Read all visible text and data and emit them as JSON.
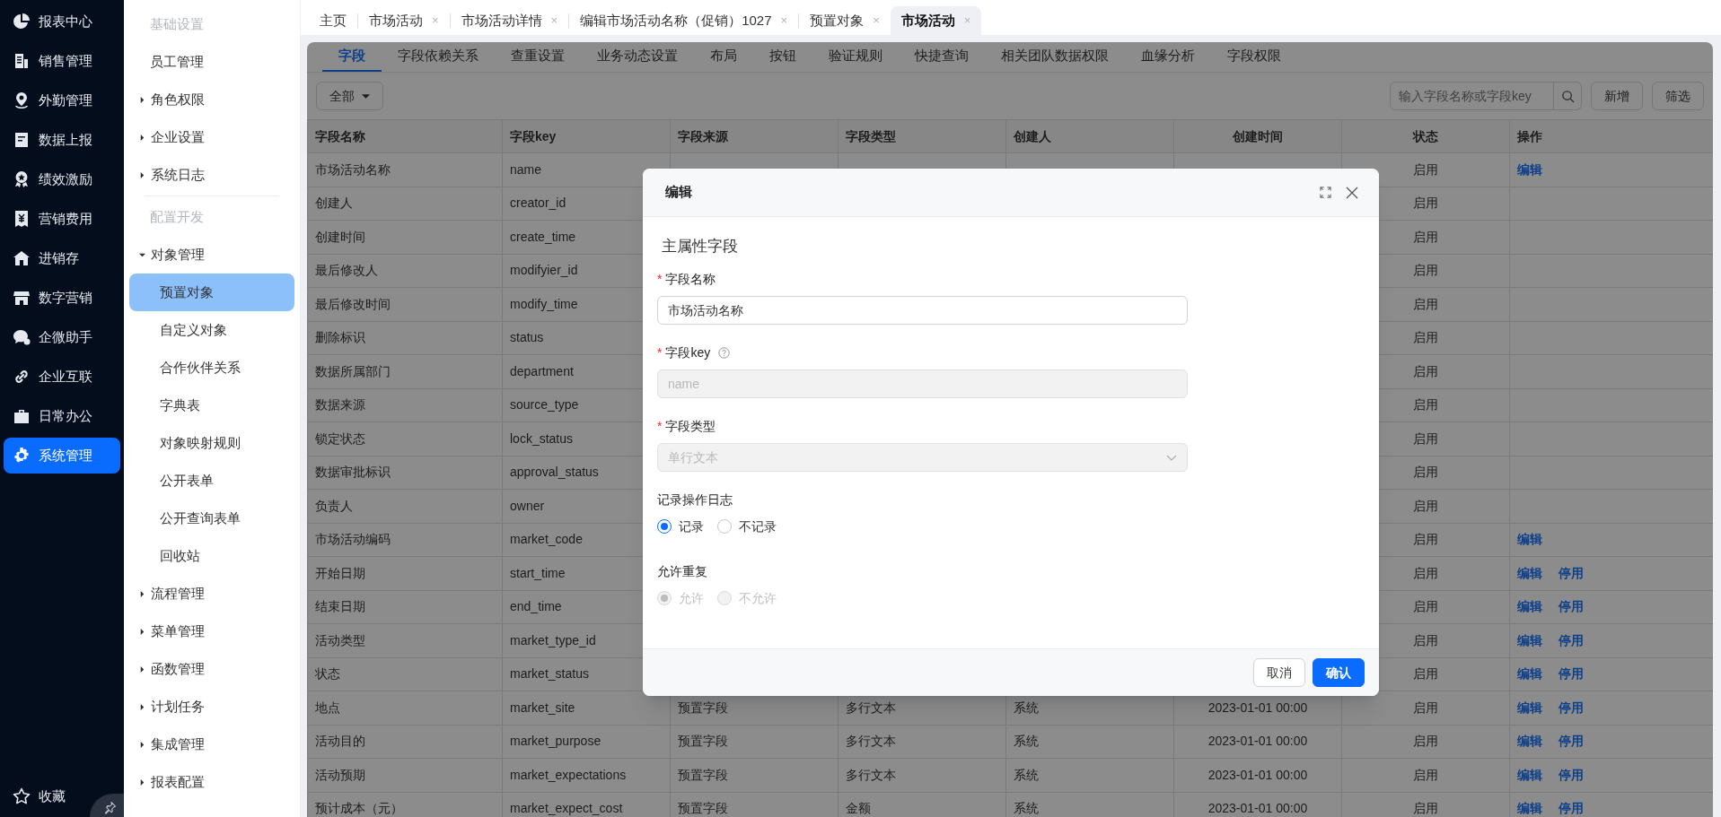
{
  "nav": {
    "items": [
      {
        "label": "报表中心",
        "selected": false
      },
      {
        "label": "销售管理",
        "selected": false
      },
      {
        "label": "外勤管理",
        "selected": false
      },
      {
        "label": "数据上报",
        "selected": false
      },
      {
        "label": "绩效激励",
        "selected": false
      },
      {
        "label": "营销费用",
        "selected": false
      },
      {
        "label": "进销存",
        "selected": false
      },
      {
        "label": "数字营销",
        "selected": false
      },
      {
        "label": "企微助手",
        "selected": false
      },
      {
        "label": "企业互联",
        "selected": false
      },
      {
        "label": "日常办公",
        "selected": false
      },
      {
        "label": "系统管理",
        "selected": true
      }
    ],
    "favorites": "收藏"
  },
  "menu": {
    "sections": [
      {
        "title": "基础设置",
        "items": [
          {
            "label": "员工管理",
            "kind": "link",
            "selected": false
          },
          {
            "label": "角色权限",
            "kind": "folder",
            "expanded": false
          },
          {
            "label": "企业设置",
            "kind": "folder",
            "expanded": false
          },
          {
            "label": "系统日志",
            "kind": "folder",
            "expanded": false
          }
        ]
      },
      {
        "title": "配置开发",
        "items": [
          {
            "label": "对象管理",
            "kind": "folder",
            "expanded": true,
            "children": [
              {
                "label": "预置对象",
                "selected": true
              },
              {
                "label": "自定义对象",
                "selected": false
              },
              {
                "label": "合作伙伴关系",
                "selected": false
              },
              {
                "label": "字典表",
                "selected": false
              },
              {
                "label": "对象映射规则",
                "selected": false
              },
              {
                "label": "公开表单",
                "selected": false
              },
              {
                "label": "公开查询表单",
                "selected": false
              },
              {
                "label": "回收站",
                "selected": false
              }
            ]
          },
          {
            "label": "流程管理",
            "kind": "folder",
            "expanded": false
          },
          {
            "label": "菜单管理",
            "kind": "folder",
            "expanded": false
          },
          {
            "label": "函数管理",
            "kind": "folder",
            "expanded": false
          },
          {
            "label": "计划任务",
            "kind": "folder",
            "expanded": false
          },
          {
            "label": "集成管理",
            "kind": "folder",
            "expanded": false
          },
          {
            "label": "报表配置",
            "kind": "folder",
            "expanded": false
          }
        ]
      }
    ]
  },
  "tabs": [
    {
      "label": "主页",
      "closable": false,
      "selected": false
    },
    {
      "label": "市场活动",
      "closable": true,
      "selected": false
    },
    {
      "label": "市场活动详情",
      "closable": true,
      "selected": false
    },
    {
      "label": "编辑市场活动名称（促销）1027",
      "closable": true,
      "selected": false
    },
    {
      "label": "预置对象",
      "closable": true,
      "selected": false
    },
    {
      "label": "市场活动",
      "closable": true,
      "selected": true
    }
  ],
  "close_mark": "×",
  "subtabs": [
    {
      "label": "字段",
      "selected": true
    },
    {
      "label": "字段依赖关系",
      "selected": false
    },
    {
      "label": "查重设置",
      "selected": false
    },
    {
      "label": "业务动态设置",
      "selected": false
    },
    {
      "label": "布局",
      "selected": false
    },
    {
      "label": "按钮",
      "selected": false
    },
    {
      "label": "验证规则",
      "selected": false
    },
    {
      "label": "快捷查询",
      "selected": false
    },
    {
      "label": "相关团队数据权限",
      "selected": false
    },
    {
      "label": "血缘分析",
      "selected": false
    },
    {
      "label": "字段权限",
      "selected": false
    }
  ],
  "toolbar": {
    "filter": "全部",
    "search": {
      "placeholder": "输入字段名称或字段key"
    },
    "buttons": [
      "新增",
      "筛选"
    ]
  },
  "table": {
    "columns": [
      "字段名称",
      "字段key",
      "字段来源",
      "字段类型",
      "创建人",
      "创建时间",
      "状态",
      "操作"
    ],
    "rows": [
      {
        "name": "市场活动名称",
        "key": "name",
        "status": "启用",
        "actions": [
          "编辑"
        ]
      },
      {
        "name": "创建人",
        "key": "creator_id",
        "status": "启用"
      },
      {
        "name": "创建时间",
        "key": "create_time",
        "status": "启用"
      },
      {
        "name": "最后修改人",
        "key": "modifyier_id",
        "status": "启用"
      },
      {
        "name": "最后修改时间",
        "key": "modify_time",
        "status": "启用"
      },
      {
        "name": "删除标识",
        "key": "status",
        "status": "启用"
      },
      {
        "name": "数据所属部门",
        "key": "department",
        "status": "启用"
      },
      {
        "name": "数据来源",
        "key": "source_type",
        "status": "启用"
      },
      {
        "name": "锁定状态",
        "key": "lock_status",
        "status": "启用"
      },
      {
        "name": "数据审批标识",
        "key": "approval_status",
        "status": "启用"
      },
      {
        "name": "负责人",
        "key": "owner",
        "status": "启用"
      },
      {
        "name": "市场活动编码",
        "key": "market_code",
        "status": "启用",
        "actions": [
          "编辑"
        ]
      },
      {
        "name": "开始日期",
        "key": "start_time",
        "status": "启用",
        "actions": [
          "编辑",
          "停用"
        ]
      },
      {
        "name": "结束日期",
        "key": "end_time",
        "status": "启用",
        "actions": [
          "编辑",
          "停用"
        ]
      },
      {
        "name": "活动类型",
        "key": "market_type_id",
        "status": "启用",
        "actions": [
          "编辑",
          "停用"
        ]
      },
      {
        "name": "状态",
        "key": "market_status",
        "status": "启用",
        "actions": [
          "编辑",
          "停用"
        ]
      },
      {
        "name": "地点",
        "key": "market_site",
        "source": "预置字段",
        "type": "多行文本",
        "creator": "系统",
        "created": "2023-01-01 00:00",
        "status": "启用",
        "actions": [
          "编辑",
          "停用"
        ]
      },
      {
        "name": "活动目的",
        "key": "market_purpose",
        "source": "预置字段",
        "type": "多行文本",
        "creator": "系统",
        "created": "2023-01-01 00:00",
        "status": "启用",
        "actions": [
          "编辑",
          "停用"
        ]
      },
      {
        "name": "活动预期",
        "key": "market_expectations",
        "source": "预置字段",
        "type": "多行文本",
        "creator": "系统",
        "created": "2023-01-01 00:00",
        "status": "启用",
        "actions": [
          "编辑",
          "停用"
        ]
      },
      {
        "name": "预计成本（元）",
        "key": "market_expect_cost",
        "source": "预置字段",
        "type": "金额",
        "creator": "系统",
        "created": "2023-01-01 00:00",
        "status": "启用",
        "actions": [
          "编辑",
          "停用"
        ]
      }
    ]
  },
  "dialog": {
    "title": "编辑",
    "section": "主属性字段",
    "required_mark": "*",
    "fields": [
      {
        "kind": "text",
        "label": "字段名称",
        "required": true,
        "help": false,
        "disabled": false,
        "value": "市场活动名称"
      },
      {
        "kind": "text",
        "label": "字段key",
        "required": true,
        "help": true,
        "disabled": true,
        "value": "name"
      },
      {
        "kind": "select",
        "label": "字段类型",
        "required": true,
        "help": false,
        "disabled": true,
        "value": "单行文本"
      },
      {
        "kind": "radio",
        "label": "记录操作日志",
        "required": false,
        "help": false,
        "disabled": false,
        "options": [
          {
            "label": "记录",
            "selected": true
          },
          {
            "label": "不记录",
            "selected": false
          }
        ]
      },
      {
        "kind": "radio",
        "label": "允许重复",
        "required": false,
        "help": false,
        "disabled": true,
        "options": [
          {
            "label": "允许",
            "selected": true
          },
          {
            "label": "不允许",
            "selected": false
          }
        ]
      }
    ],
    "buttons": [
      {
        "label": "取消",
        "kind": "secondary"
      },
      {
        "label": "确认",
        "kind": "primary"
      }
    ]
  }
}
